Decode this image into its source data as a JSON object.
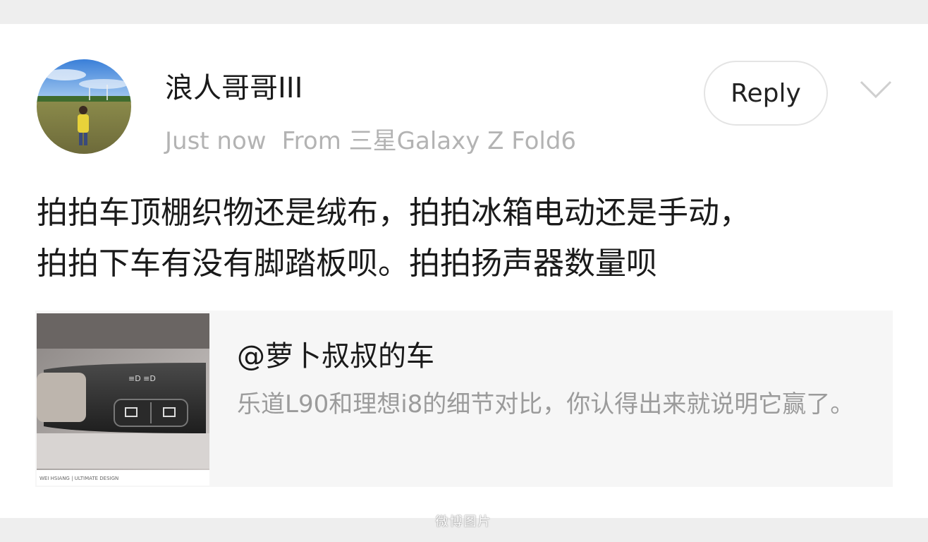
{
  "post": {
    "username": "浪人哥哥III",
    "time": "Just now",
    "source": "From 三星Galaxy Z Fold6",
    "reply_label": "Reply",
    "body_line1": "拍拍车顶棚织物还是绒布，拍拍冰箱电动还是手动，",
    "body_line2": "拍拍下车有没有脚踏板呗。拍拍扬声器数量呗"
  },
  "quoted": {
    "title": "@萝卜叔叔的车",
    "description": "乐道L90和理想i8的细节对比，你认得出来就说明它赢了。",
    "thumbnail_icon": "car-stalk-photo"
  },
  "watermark": "微博图片",
  "colors": {
    "background": "#ffffff",
    "band": "#eeeeee",
    "meta_text": "#b3b3b3",
    "card_bg": "#f6f6f6",
    "card_desc": "#9b9b9b"
  }
}
